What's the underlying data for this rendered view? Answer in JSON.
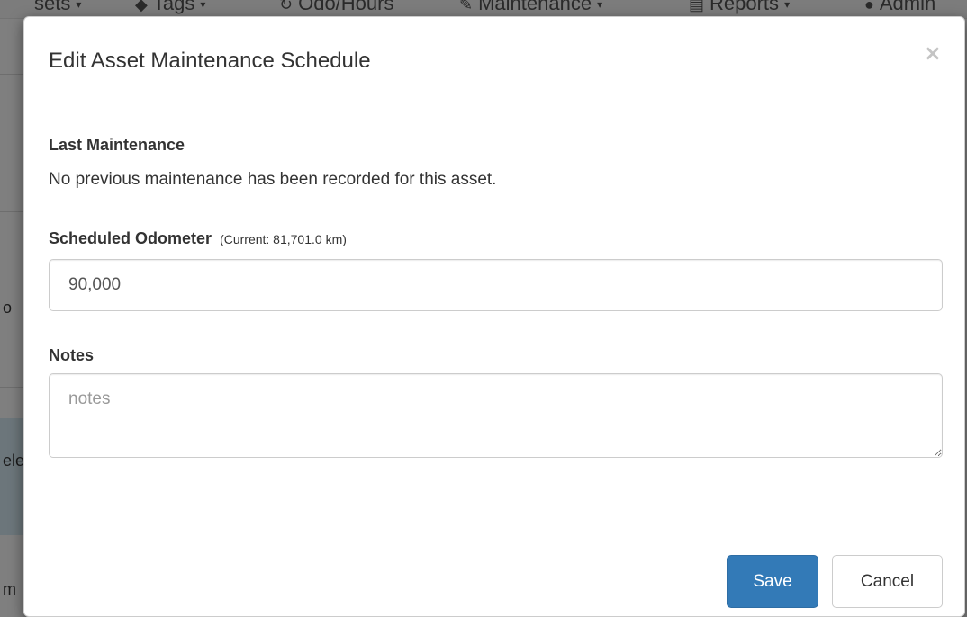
{
  "background": {
    "nav_items": [
      {
        "label": "sets",
        "caret": "▾"
      },
      {
        "label": "Tags",
        "caret": "▾"
      },
      {
        "label": "Odo/Hours"
      },
      {
        "label": "Maintenance",
        "caret": "▾"
      },
      {
        "label": "Reports",
        "caret": "▾"
      },
      {
        "label": "Admin"
      }
    ],
    "fragments": [
      "o",
      "ele",
      "m"
    ]
  },
  "modal": {
    "title": "Edit Asset Maintenance Schedule",
    "close_label": "×",
    "last_maintenance": {
      "heading": "Last Maintenance",
      "text": "No previous maintenance has been recorded for this asset."
    },
    "odometer": {
      "label": "Scheduled Odometer",
      "hint": "(Current: 81,701.0 km)",
      "value": "90,000"
    },
    "notes": {
      "label": "Notes",
      "placeholder": "notes",
      "value": ""
    },
    "save_label": "Save",
    "cancel_label": "Cancel"
  },
  "colors": {
    "primary": "#337ab7",
    "overlay": "rgba(0,0,0,0.5)"
  }
}
